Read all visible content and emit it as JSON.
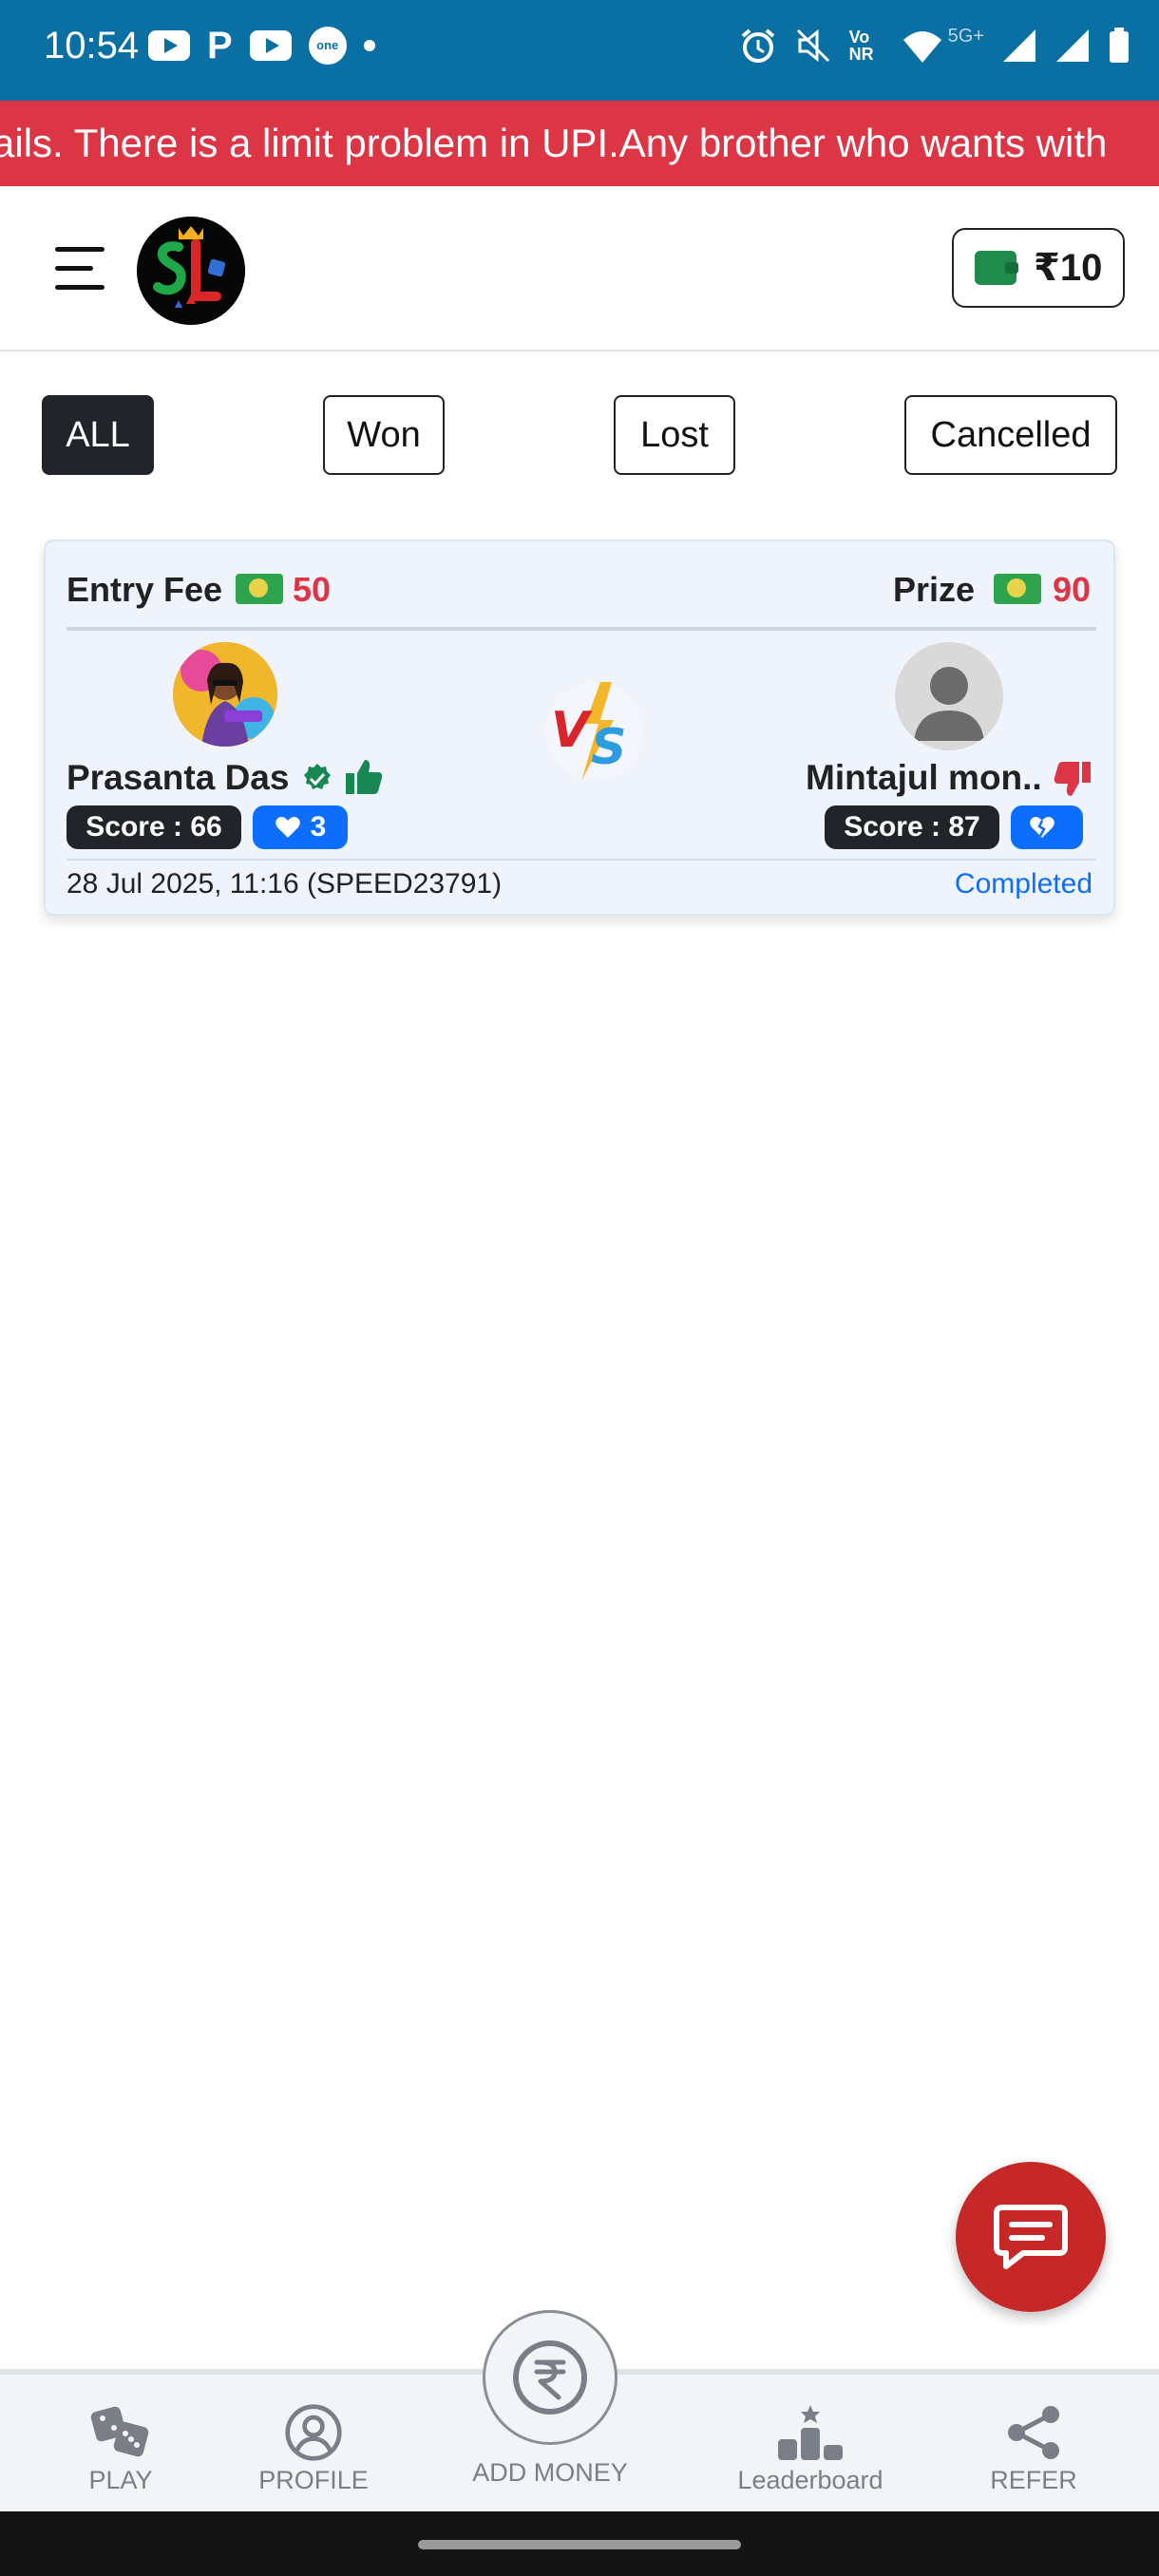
{
  "status_bar": {
    "time": "10:54",
    "network_label": "5G+",
    "volte_label": "Vo NR"
  },
  "announcement": {
    "text": "ails. There is a limit problem in UPI.Any brother who wants with"
  },
  "header": {
    "wallet_amount": "₹10",
    "logo_icon": "sl-logo",
    "menu_icon": "hamburger-icon"
  },
  "filters": [
    {
      "label": "ALL",
      "active": true
    },
    {
      "label": "Won",
      "active": false
    },
    {
      "label": "Lost",
      "active": false
    },
    {
      "label": "Cancelled",
      "active": false
    }
  ],
  "match": {
    "entry_fee_label": "Entry Fee",
    "entry_fee": "50",
    "prize_label": "Prize",
    "prize": "90",
    "player1": {
      "name": "Prasanta Das",
      "score": "Score : 66",
      "hearts": "3"
    },
    "player2": {
      "name": "Mintajul mon..",
      "score": "Score : 87",
      "hearts": ""
    },
    "datetime": "28 Jul 2025, 11:16 (SPEED23791)",
    "status": "Completed",
    "colors": {
      "fee": "#dc3545",
      "status": "#0d6efd",
      "verified": "#198754",
      "thumbs_down": "#dc3545"
    }
  },
  "bottom_nav": {
    "play": "PLAY",
    "profile": "PROFILE",
    "add_money": "ADD MONEY",
    "leaderboard": "Leaderboard",
    "refer": "REFER"
  }
}
